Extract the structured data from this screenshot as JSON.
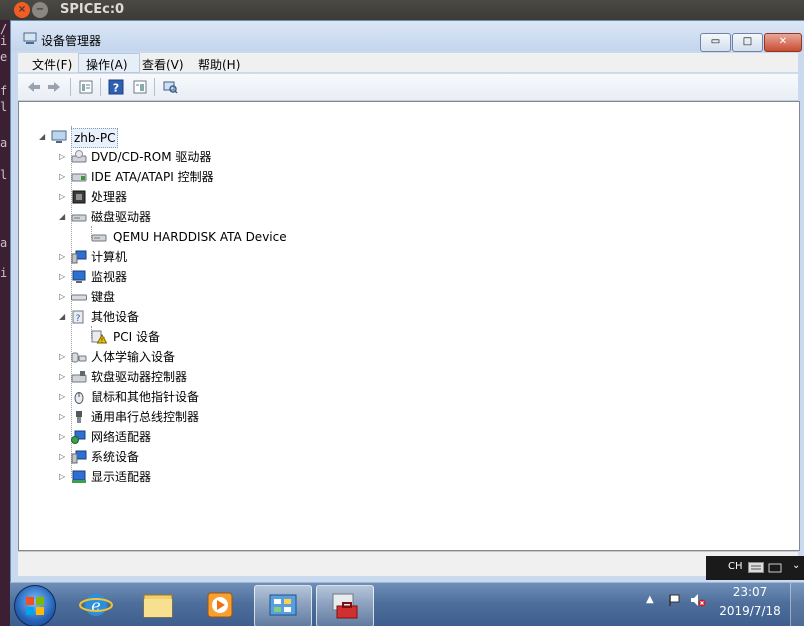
{
  "host": {
    "title": "SPICEc:0",
    "close_glyph": "×",
    "min_glyph": "−",
    "strip_chars": [
      "/",
      "i",
      "e",
      "f",
      "l",
      "a",
      "l",
      "a",
      "i"
    ]
  },
  "window": {
    "title": "设备管理器",
    "min_glyph": "▭",
    "max_glyph": "□",
    "close_glyph": "✕"
  },
  "menu": {
    "file": "文件(F)",
    "action": "操作(A)",
    "view": "查看(V)",
    "help": "帮助(H)"
  },
  "toolbar": {
    "icons": [
      "back-arrow-icon",
      "forward-arrow-icon",
      "properties-icon",
      "help-icon",
      "show-hide-icon",
      "scan-hardware-icon"
    ]
  },
  "tree": {
    "root": "zhb-PC",
    "nodes": [
      {
        "label": "DVD/CD-ROM 驱动器",
        "expanded": false,
        "icon": "dvd-drive-icon"
      },
      {
        "label": "IDE ATA/ATAPI 控制器",
        "expanded": false,
        "icon": "ide-controller-icon"
      },
      {
        "label": "处理器",
        "expanded": false,
        "icon": "processor-icon"
      },
      {
        "label": "磁盘驱动器",
        "expanded": true,
        "icon": "disk-drive-icon"
      },
      {
        "label": "QEMU HARDDISK ATA Device",
        "child": true,
        "icon": "harddisk-icon"
      },
      {
        "label": "计算机",
        "expanded": false,
        "icon": "computer-icon"
      },
      {
        "label": "监视器",
        "expanded": false,
        "icon": "monitor-icon"
      },
      {
        "label": "键盘",
        "expanded": false,
        "icon": "keyboard-icon"
      },
      {
        "label": "其他设备",
        "expanded": true,
        "icon": "other-devices-icon"
      },
      {
        "label": "PCI 设备",
        "child": true,
        "icon": "pci-warning-icon"
      },
      {
        "label": "人体学输入设备",
        "expanded": false,
        "icon": "hid-icon"
      },
      {
        "label": "软盘驱动器控制器",
        "expanded": false,
        "icon": "floppy-controller-icon"
      },
      {
        "label": "鼠标和其他指针设备",
        "expanded": false,
        "icon": "mouse-icon"
      },
      {
        "label": "通用串行总线控制器",
        "expanded": false,
        "icon": "usb-controller-icon"
      },
      {
        "label": "网络适配器",
        "expanded": false,
        "icon": "network-adapter-icon"
      },
      {
        "label": "系统设备",
        "expanded": false,
        "icon": "system-devices-icon"
      },
      {
        "label": "显示适配器",
        "expanded": false,
        "icon": "display-adapter-icon"
      }
    ]
  },
  "tray": {
    "ime": "CH",
    "time": "23:07",
    "date": "2019/7/18",
    "up_glyph": "▲"
  },
  "taskbar": {
    "apps": [
      "internet-explorer-icon",
      "file-explorer-icon",
      "media-player-icon",
      "control-panel-icon",
      "device-manager-icon"
    ]
  },
  "colors": {
    "accent": "#2b5a8f",
    "window_frame": "#c9d9ee",
    "close_red": "#c94c31",
    "host_close": "#f15d22"
  }
}
